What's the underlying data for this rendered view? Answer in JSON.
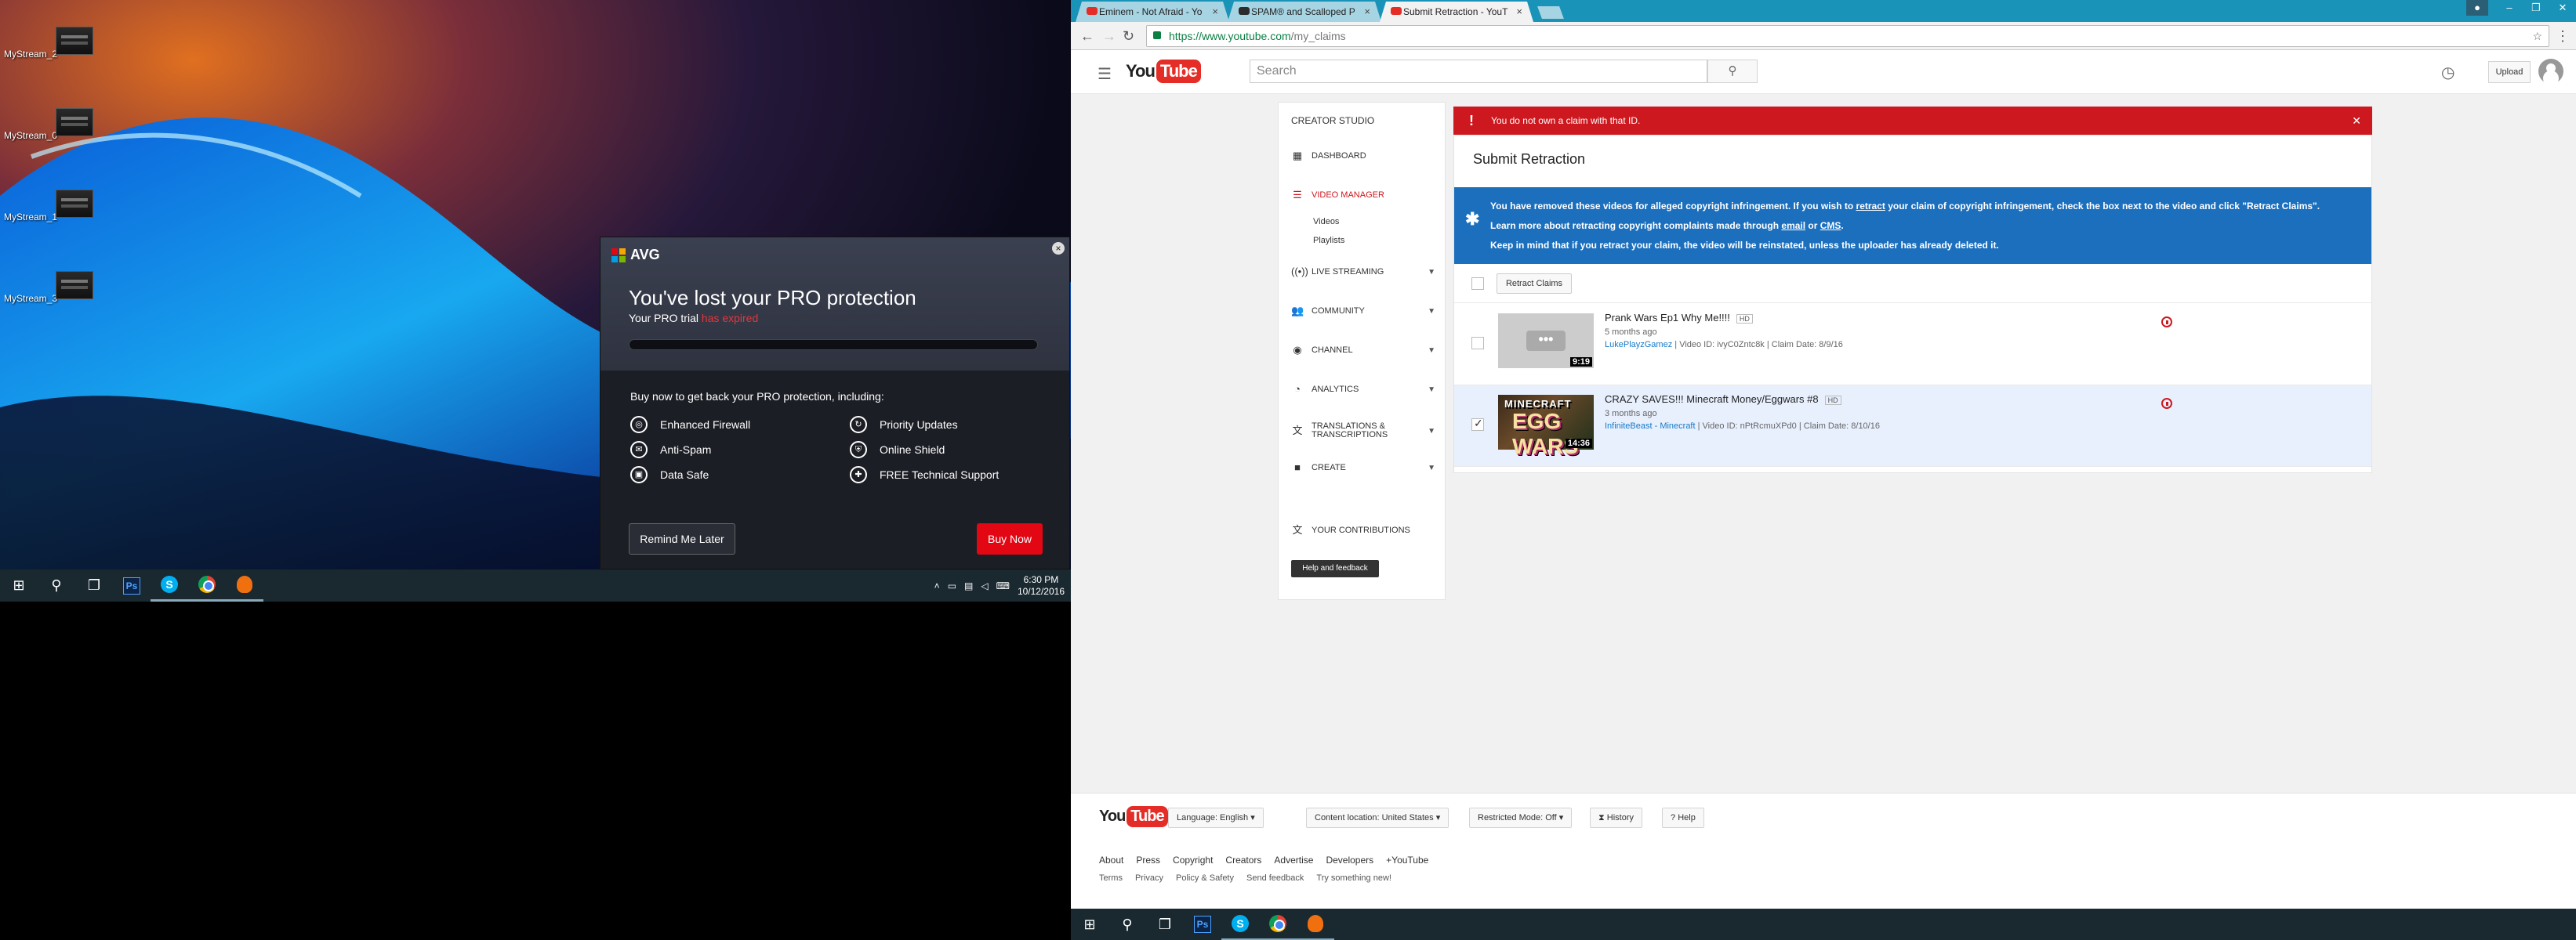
{
  "desktop": {
    "icons": [
      {
        "label": "MyStream_2"
      },
      {
        "label": "MyStream_0"
      },
      {
        "label": "MyStream_1"
      },
      {
        "label": "MyStream_3"
      }
    ]
  },
  "avg_popup": {
    "brand": "AVG",
    "close_glyph": "×",
    "title": "You've lost your PRO protection",
    "subtitle_prefix": "Your PRO trial ",
    "subtitle_status": "has expired",
    "buy_text": "Buy now to get back your PRO protection, including:",
    "features": [
      {
        "label": "Enhanced Firewall",
        "icon": "firewall-icon"
      },
      {
        "label": "Priority Updates",
        "icon": "updates-icon"
      },
      {
        "label": "Anti-Spam",
        "icon": "antispam-icon"
      },
      {
        "label": "Online Shield",
        "icon": "shield-icon"
      },
      {
        "label": "Data Safe",
        "icon": "lock-icon"
      },
      {
        "label": "FREE Technical Support",
        "icon": "support-icon"
      }
    ],
    "remind_label": "Remind Me Later",
    "buy_label": "Buy Now",
    "colors": {
      "buy": "#e30613",
      "expired": "#e3363c"
    }
  },
  "left_taskbar": {
    "time": "6:30 PM",
    "date": "10/12/2016",
    "ps_label": "Ps",
    "skype_label": "S"
  },
  "browser": {
    "tabs": [
      {
        "title": "Eminem - Not Afraid - Yo"
      },
      {
        "title": "SPAM® and Scalloped P"
      },
      {
        "title": "Submit Retraction - YouT"
      }
    ],
    "url_scheme": "https://",
    "url_host": "www.youtube.com",
    "url_path": "/my_claims"
  },
  "youtube": {
    "logo_you": "You",
    "logo_tube": "Tube",
    "search_placeholder": "Search",
    "upload_label": "Upload",
    "sidebar": {
      "title": "CREATOR STUDIO",
      "items": [
        {
          "label": "DASHBOARD",
          "icon": "dashboard-icon"
        },
        {
          "label": "VIDEO MANAGER",
          "icon": "video-manager-icon"
        },
        {
          "label": "LIVE STREAMING",
          "icon": "live-icon"
        },
        {
          "label": "COMMUNITY",
          "icon": "community-icon"
        },
        {
          "label": "CHANNEL",
          "icon": "channel-icon"
        },
        {
          "label": "ANALYTICS",
          "icon": "analytics-icon"
        },
        {
          "label": "TRANSLATIONS & TRANSCRIPTIONS",
          "icon": "translate-icon"
        },
        {
          "label": "CREATE",
          "icon": "create-icon"
        },
        {
          "label": "YOUR CONTRIBUTIONS",
          "icon": "contributions-icon"
        }
      ],
      "sub_items": [
        "Videos",
        "Playlists"
      ],
      "help_label": "Help and feedback"
    },
    "alert": "You do not own a claim with that ID.",
    "page_title": "Submit Retraction",
    "info": {
      "line1_a": "You have removed these videos for alleged copyright infringement. If you wish to ",
      "line1_link": "retract",
      "line1_b": " your claim of copyright infringement, check the box next to the video and click \"Retract Claims\".",
      "line2_a": "Learn more about retracting copyright complaints made through ",
      "line2_link1": "email",
      "line2_mid": " or ",
      "line2_link2": "CMS",
      "line2_end": ".",
      "line3": "Keep in mind that if you retract your claim, the video will be reinstated, unless the uploader has already deleted it."
    },
    "retract_label": "Retract Claims",
    "videos": [
      {
        "title": "Prank Wars Ep1 Why Me!!!!",
        "hd": "HD",
        "age": "5 months ago",
        "channel": "LukePlayzGamez",
        "meta": " | Video ID: ivyC0Zntc8k | Claim Date: 8/9/16",
        "duration": "9:19",
        "checked": false
      },
      {
        "title": "CRAZY SAVES!!! Minecraft Money/Eggwars #8",
        "hd": "HD",
        "age": "3 months ago",
        "channel": "InfiniteBeast - Minecraft",
        "meta": " | Video ID: nPtRcmuXPd0 | Claim Date: 8/10/16",
        "duration": "14:36",
        "thumb_text_top": "MINECRAFT",
        "thumb_text_big": "EGG WARS",
        "checked": true
      }
    ],
    "footer": {
      "language": "Language: English",
      "location": "Content location: United States",
      "restricted": "Restricted Mode: Off",
      "history": "History",
      "help": "Help",
      "links": [
        "About",
        "Press",
        "Copyright",
        "Creators",
        "Advertise",
        "Developers",
        "+YouTube"
      ],
      "links2": [
        "Terms",
        "Privacy",
        "Policy & Safety",
        "Send feedback",
        "Try something new!"
      ]
    },
    "colors": {
      "red": "#cc181e",
      "info_blue": "#1c6fbd",
      "link": "#167ac6"
    }
  }
}
